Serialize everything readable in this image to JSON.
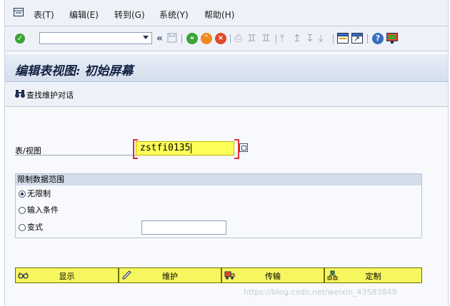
{
  "menubar": {
    "items": [
      {
        "label": "表(T)"
      },
      {
        "label": "编辑(E)"
      },
      {
        "label": "转到(G)"
      },
      {
        "label": "系统(Y)"
      },
      {
        "label": "帮助(H)"
      }
    ]
  },
  "toolbar": {
    "command_field_value": "",
    "icons": [
      "enter-icon",
      "command-field-dropdown-icon",
      "collapse-icon",
      "save-icon",
      "back-icon",
      "exit-icon",
      "cancel-icon",
      "print-icon",
      "find-icon",
      "find-next-icon",
      "first-page-icon",
      "previous-page-icon",
      "next-page-icon",
      "last-page-icon",
      "create-session-icon",
      "shortcut-icon",
      "help-icon",
      "customize-layout-icon"
    ]
  },
  "title": {
    "text": "编辑表视图: 初始屏幕"
  },
  "app_toolbar": {
    "find_label": "查找维护对话"
  },
  "form": {
    "table_view_label": "表/视图",
    "table_view_value": "zstfi0135"
  },
  "restrict_group": {
    "title": "限制数据范围",
    "options": [
      {
        "label": "无限制",
        "selected": true
      },
      {
        "label": "输入条件",
        "selected": false
      },
      {
        "label": "变式",
        "selected": false
      }
    ],
    "variant_value": ""
  },
  "actions": [
    {
      "label": "显示",
      "icon": "glasses-icon"
    },
    {
      "label": "维护",
      "icon": "pencil-icon"
    },
    {
      "label": "传输",
      "icon": "transport-truck-icon"
    },
    {
      "label": "定制",
      "icon": "hierarchy-icon"
    }
  ],
  "watermark": {
    "text": "https://blog.csdn.net/weixin_43583849"
  },
  "colors": {
    "button_yellow": "#f6f65e",
    "input_yellow": "#ffff5a",
    "header_blue": "#d4deec",
    "ok_green": "#3aa434",
    "exit_orange": "#f08a1c",
    "cancel_red": "#e0482a"
  }
}
